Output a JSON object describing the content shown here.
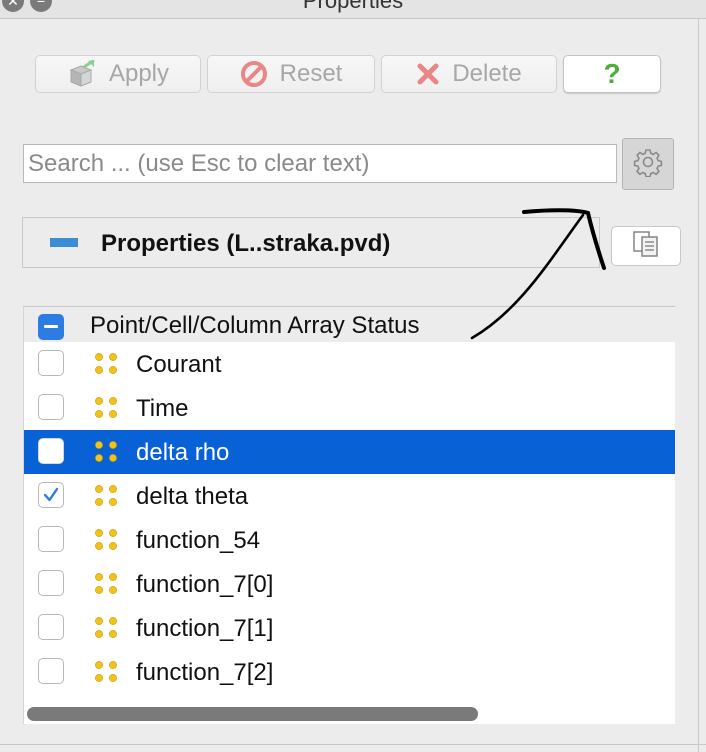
{
  "window": {
    "title": "Properties"
  },
  "toolbar": {
    "apply_label": "Apply",
    "reset_label": "Reset",
    "delete_label": "Delete",
    "help_label": "?"
  },
  "search": {
    "placeholder": "Search ... (use Esc to clear text)"
  },
  "section": {
    "title": "Properties (L..straka.pvd)"
  },
  "array_status": {
    "header": "Point/Cell/Column Array Status",
    "rows": [
      {
        "label": "Courant",
        "checked": false,
        "selected": false
      },
      {
        "label": "Time",
        "checked": false,
        "selected": false
      },
      {
        "label": "delta rho",
        "checked": false,
        "selected": true
      },
      {
        "label": "delta theta",
        "checked": true,
        "selected": false
      },
      {
        "label": "function_54",
        "checked": false,
        "selected": false
      },
      {
        "label": "function_7[0]",
        "checked": false,
        "selected": false
      },
      {
        "label": "function_7[1]",
        "checked": false,
        "selected": false
      },
      {
        "label": "function_7[2]",
        "checked": false,
        "selected": false
      }
    ]
  },
  "colors": {
    "selection": "#0961d6",
    "checkbox_accent": "#2c7de3",
    "collapse_accent": "#3a8fd4",
    "point_icon": "#f2c21b",
    "help_icon": "#4caf3c",
    "reset_icon": "#e05252",
    "delete_icon": "#e05252"
  },
  "icons": {
    "apply": "apply-cube-icon",
    "reset": "no-entry-icon",
    "delete": "x-mark-icon",
    "settings": "gear-icon",
    "copy": "copy-documents-icon",
    "point_array": "point-data-icon"
  }
}
